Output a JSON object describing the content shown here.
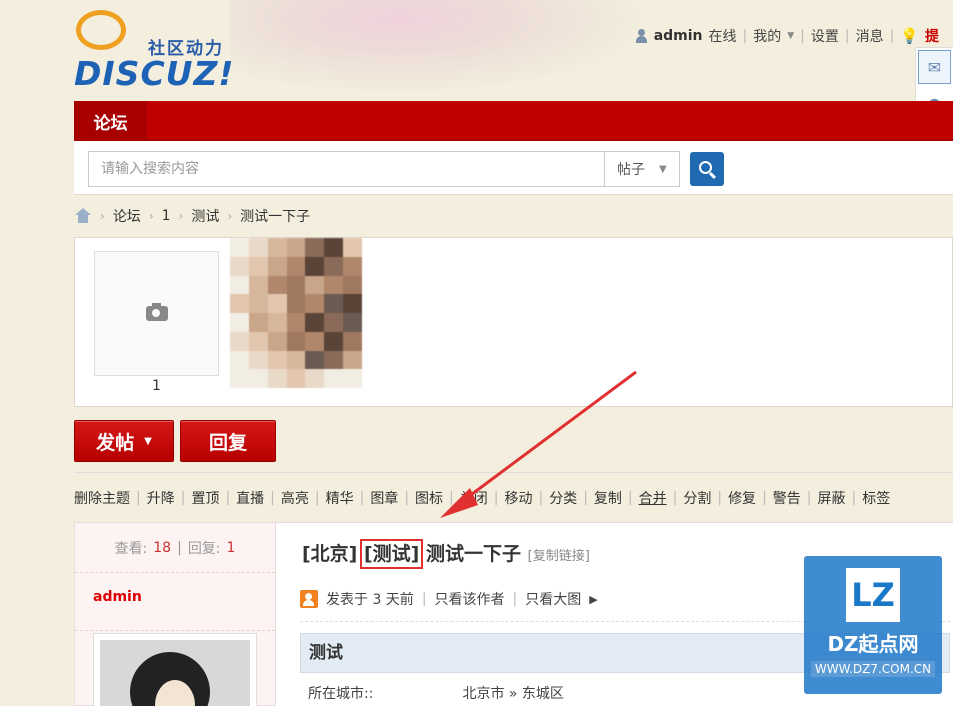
{
  "header": {
    "logo_slogan": "社区动力",
    "logo_word": "DISCUZ!",
    "user": "admin",
    "online": "在线",
    "my": "我的",
    "settings": "设置",
    "messages": "消息",
    "tip": "提"
  },
  "nav": {
    "forum": "论坛"
  },
  "search": {
    "placeholder": "请输入搜索内容",
    "type": "帖子"
  },
  "breadcrumb": [
    "论坛",
    "1",
    "测试",
    "测试一下子"
  ],
  "album": {
    "thumb_caption": "1"
  },
  "buttons": {
    "post": "发帖",
    "reply": "回复"
  },
  "moderation": [
    "删除主题",
    "升降",
    "置顶",
    "直播",
    "高亮",
    "精华",
    "图章",
    "图标",
    "关闭",
    "移动",
    "分类",
    "复制",
    "合并",
    "分割",
    "修复",
    "警告",
    "屏蔽",
    "标签"
  ],
  "post": {
    "views_label": "查看:",
    "views": "18",
    "replies_label": "回复:",
    "replies": "1",
    "author": "admin",
    "title_city": "[北京]",
    "title_tag": "[测试]",
    "title_text": "测试一下子",
    "copy_link": "[复制链接]",
    "posted": "发表于 3 天前",
    "author_only": "只看该作者",
    "big_image": "只看大图",
    "type_name": "测试",
    "field_label": "所在城市::",
    "field_value": "北京市 » 东城区"
  },
  "watermark": {
    "logo": "LZ",
    "name": "DZ起点网",
    "url": "WWW.DZ7.COM.CN"
  },
  "colors": {
    "brand_red": "#c00000",
    "link_blue": "#1f6ab0",
    "annotation": "#e03030"
  },
  "icons": [
    "user-icon",
    "chevron-down-icon",
    "bulb-icon",
    "mail-icon",
    "profile-icon",
    "link-icon",
    "home-icon",
    "search-icon",
    "camera-icon",
    "author-icon",
    "triangle-right-icon"
  ]
}
